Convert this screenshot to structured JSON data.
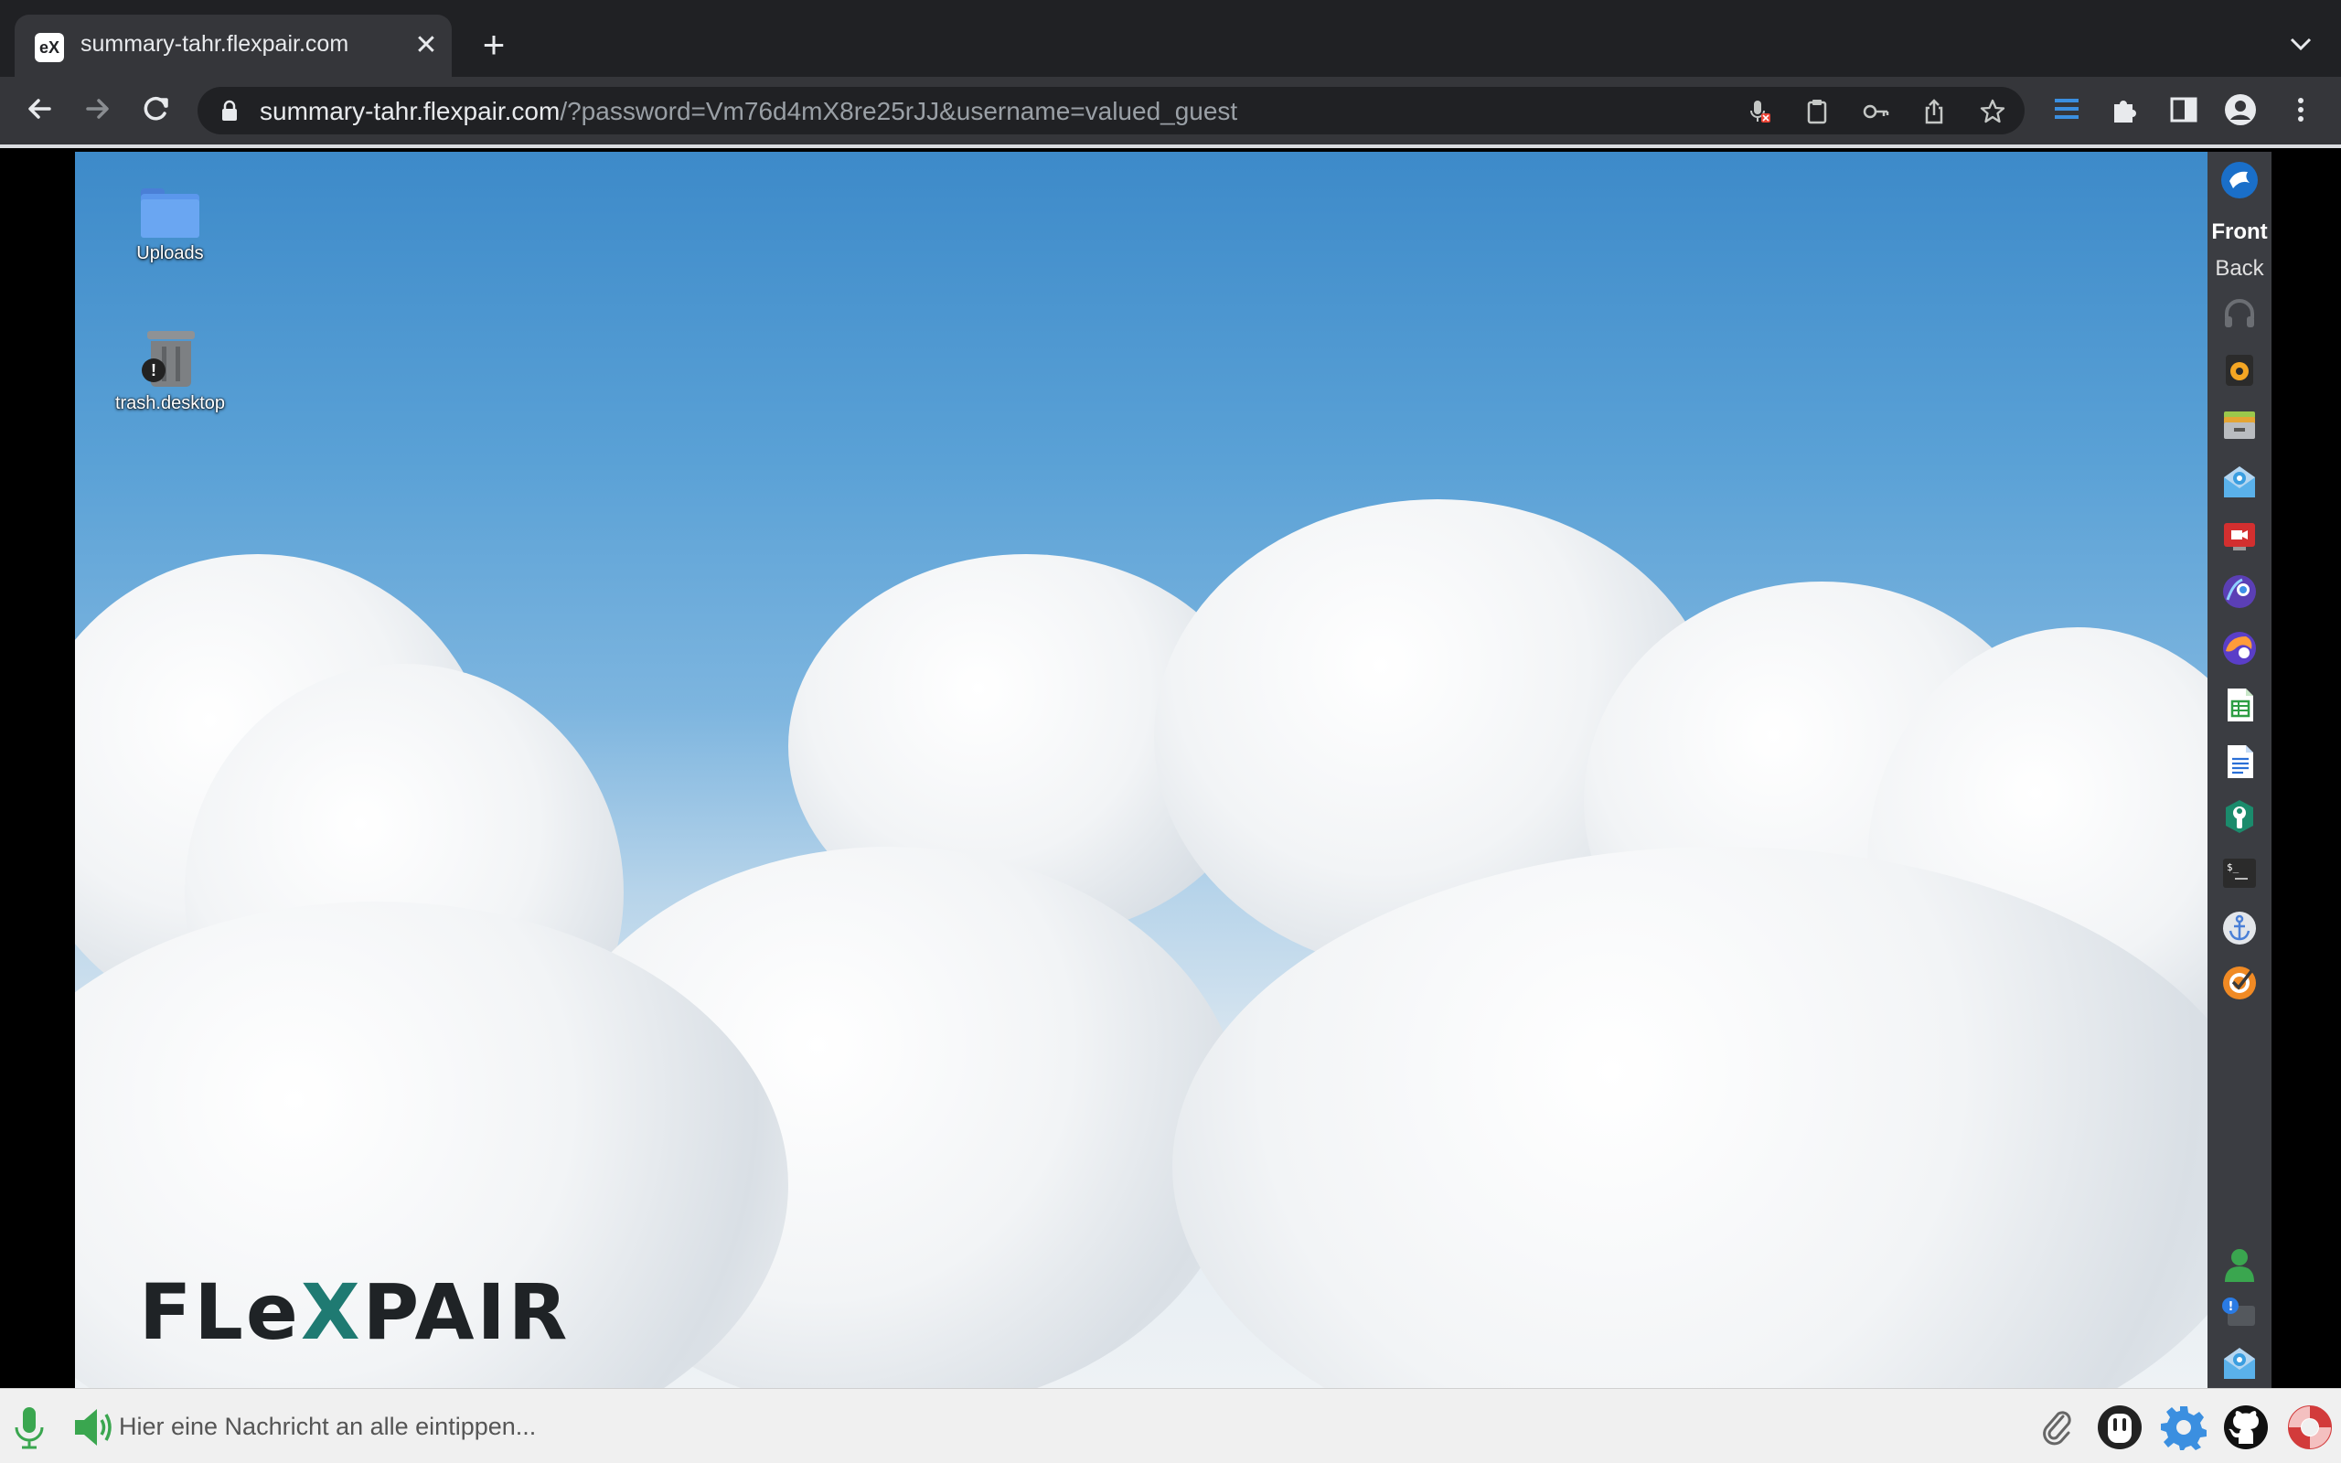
{
  "browser": {
    "tab_title": "summary-tahr.flexpair.com",
    "favicon_text": "eX",
    "url_host": "summary-tahr.flexpair.com",
    "url_rest": "/?password=Vm76d4mX8re25rJJ&username=valued_guest"
  },
  "desktop": {
    "icons": [
      {
        "label": "Uploads",
        "icon": "folder-icon"
      },
      {
        "label": "trash.desktop",
        "icon": "trash-icon"
      }
    ],
    "logo_parts": {
      "a": "FLe",
      "b": "X",
      "c": "PAIR"
    }
  },
  "dock": {
    "front_label": "Front",
    "back_label": "Back",
    "apps": [
      "thunderbird-icon",
      "headphones-icon",
      "speaker-icon",
      "archive-icon",
      "mail-settings-icon",
      "video-call-icon",
      "privacy-icon",
      "browser-icon",
      "spreadsheet-icon",
      "document-icon",
      "wrench-icon",
      "terminal-icon",
      "anchor-icon",
      "orange-app-icon",
      "user-icon",
      "notification-icon",
      "mail-icon"
    ]
  },
  "bottom_bar": {
    "chat_placeholder": "Hier eine Nachricht an alle eintippen..."
  },
  "colors": {
    "browser_bg": "#202124",
    "toolbar_bg": "#35363a",
    "dock_bg": "#3b3d42",
    "accent_green": "#3aa64f",
    "accent_blue": "#3b8fe0",
    "logo_teal": "#1f7a72"
  }
}
